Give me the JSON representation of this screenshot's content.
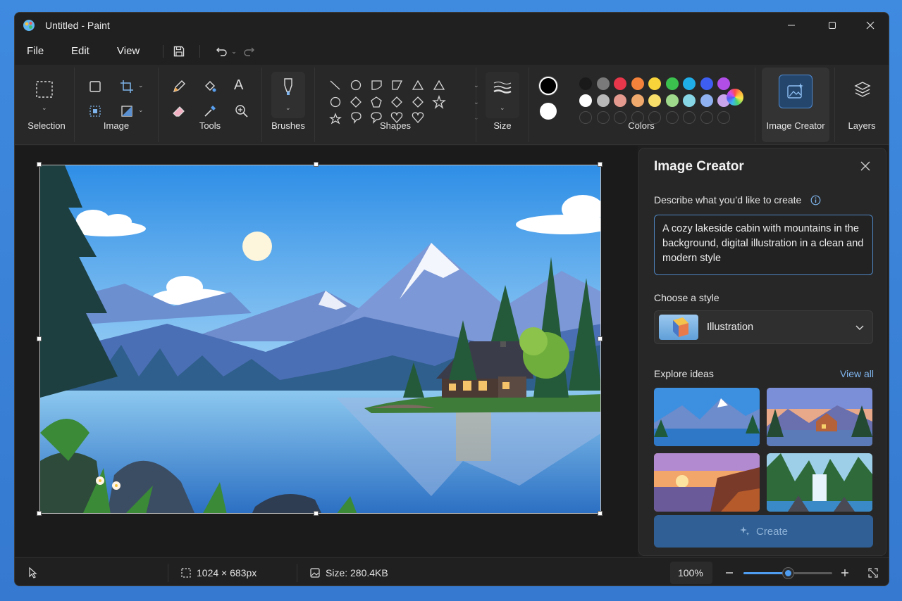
{
  "window": {
    "title": "Untitled - Paint"
  },
  "menu": {
    "file": "File",
    "edit": "Edit",
    "view": "View"
  },
  "ribbon": {
    "selection_label": "Selection",
    "image_label": "Image",
    "tools_label": "Tools",
    "brushes_label": "Brushes",
    "shapes_label": "Shapes",
    "size_label": "Size",
    "colors_label": "Colors",
    "image_creator_label": "Image Creator",
    "layers_label": "Layers"
  },
  "colors": {
    "primary": "#000000",
    "secondary": "#ffffff",
    "row1": [
      "#1a1a1a",
      "#7a7a7a",
      "#e8364a",
      "#f4823b",
      "#f8d43a",
      "#3bc24e",
      "#20aee8",
      "#3d5ef0",
      "#b14ee8"
    ],
    "row2": [
      "#ffffff",
      "#b8b8b8",
      "#e59a8f",
      "#f0a96c",
      "#f7dd6a",
      "#9fd98c",
      "#86d6e6",
      "#8fb1ef",
      "#c9a5ec"
    ]
  },
  "panel": {
    "title": "Image Creator",
    "describe_label": "Describe what you’d like to create",
    "prompt": "A cozy lakeside cabin with mountains in the background, digital illustration in a clean and modern style",
    "style_label": "Choose a style",
    "style_value": "Illustration",
    "explore_label": "Explore ideas",
    "view_all": "View all",
    "create_button": "Create"
  },
  "status": {
    "dimensions": "1024 × 683px",
    "size": "Size: 280.4KB",
    "zoom": "100%",
    "zoom_fraction": 0.5
  }
}
